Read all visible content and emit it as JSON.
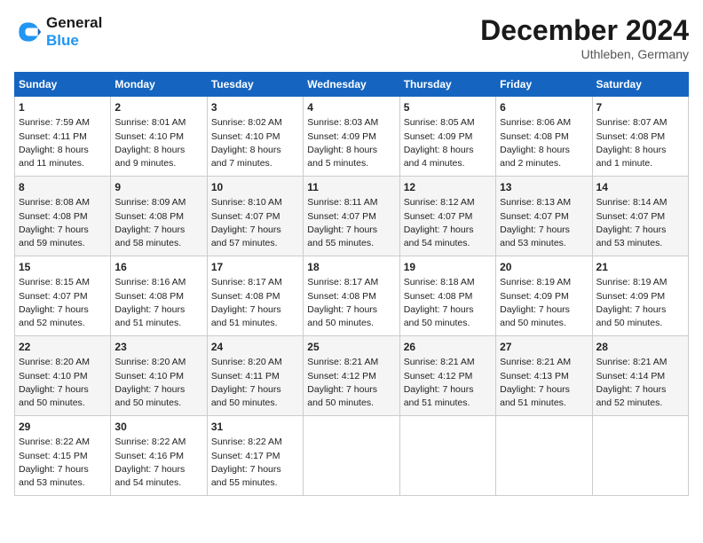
{
  "header": {
    "logo_line1": "General",
    "logo_line2": "Blue",
    "month": "December 2024",
    "location": "Uthleben, Germany"
  },
  "weekdays": [
    "Sunday",
    "Monday",
    "Tuesday",
    "Wednesday",
    "Thursday",
    "Friday",
    "Saturday"
  ],
  "weeks": [
    [
      {
        "day": "1",
        "lines": [
          "Sunrise: 7:59 AM",
          "Sunset: 4:11 PM",
          "Daylight: 8 hours",
          "and 11 minutes."
        ]
      },
      {
        "day": "2",
        "lines": [
          "Sunrise: 8:01 AM",
          "Sunset: 4:10 PM",
          "Daylight: 8 hours",
          "and 9 minutes."
        ]
      },
      {
        "day": "3",
        "lines": [
          "Sunrise: 8:02 AM",
          "Sunset: 4:10 PM",
          "Daylight: 8 hours",
          "and 7 minutes."
        ]
      },
      {
        "day": "4",
        "lines": [
          "Sunrise: 8:03 AM",
          "Sunset: 4:09 PM",
          "Daylight: 8 hours",
          "and 5 minutes."
        ]
      },
      {
        "day": "5",
        "lines": [
          "Sunrise: 8:05 AM",
          "Sunset: 4:09 PM",
          "Daylight: 8 hours",
          "and 4 minutes."
        ]
      },
      {
        "day": "6",
        "lines": [
          "Sunrise: 8:06 AM",
          "Sunset: 4:08 PM",
          "Daylight: 8 hours",
          "and 2 minutes."
        ]
      },
      {
        "day": "7",
        "lines": [
          "Sunrise: 8:07 AM",
          "Sunset: 4:08 PM",
          "Daylight: 8 hours",
          "and 1 minute."
        ]
      }
    ],
    [
      {
        "day": "8",
        "lines": [
          "Sunrise: 8:08 AM",
          "Sunset: 4:08 PM",
          "Daylight: 7 hours",
          "and 59 minutes."
        ]
      },
      {
        "day": "9",
        "lines": [
          "Sunrise: 8:09 AM",
          "Sunset: 4:08 PM",
          "Daylight: 7 hours",
          "and 58 minutes."
        ]
      },
      {
        "day": "10",
        "lines": [
          "Sunrise: 8:10 AM",
          "Sunset: 4:07 PM",
          "Daylight: 7 hours",
          "and 57 minutes."
        ]
      },
      {
        "day": "11",
        "lines": [
          "Sunrise: 8:11 AM",
          "Sunset: 4:07 PM",
          "Daylight: 7 hours",
          "and 55 minutes."
        ]
      },
      {
        "day": "12",
        "lines": [
          "Sunrise: 8:12 AM",
          "Sunset: 4:07 PM",
          "Daylight: 7 hours",
          "and 54 minutes."
        ]
      },
      {
        "day": "13",
        "lines": [
          "Sunrise: 8:13 AM",
          "Sunset: 4:07 PM",
          "Daylight: 7 hours",
          "and 53 minutes."
        ]
      },
      {
        "day": "14",
        "lines": [
          "Sunrise: 8:14 AM",
          "Sunset: 4:07 PM",
          "Daylight: 7 hours",
          "and 53 minutes."
        ]
      }
    ],
    [
      {
        "day": "15",
        "lines": [
          "Sunrise: 8:15 AM",
          "Sunset: 4:07 PM",
          "Daylight: 7 hours",
          "and 52 minutes."
        ]
      },
      {
        "day": "16",
        "lines": [
          "Sunrise: 8:16 AM",
          "Sunset: 4:08 PM",
          "Daylight: 7 hours",
          "and 51 minutes."
        ]
      },
      {
        "day": "17",
        "lines": [
          "Sunrise: 8:17 AM",
          "Sunset: 4:08 PM",
          "Daylight: 7 hours",
          "and 51 minutes."
        ]
      },
      {
        "day": "18",
        "lines": [
          "Sunrise: 8:17 AM",
          "Sunset: 4:08 PM",
          "Daylight: 7 hours",
          "and 50 minutes."
        ]
      },
      {
        "day": "19",
        "lines": [
          "Sunrise: 8:18 AM",
          "Sunset: 4:08 PM",
          "Daylight: 7 hours",
          "and 50 minutes."
        ]
      },
      {
        "day": "20",
        "lines": [
          "Sunrise: 8:19 AM",
          "Sunset: 4:09 PM",
          "Daylight: 7 hours",
          "and 50 minutes."
        ]
      },
      {
        "day": "21",
        "lines": [
          "Sunrise: 8:19 AM",
          "Sunset: 4:09 PM",
          "Daylight: 7 hours",
          "and 50 minutes."
        ]
      }
    ],
    [
      {
        "day": "22",
        "lines": [
          "Sunrise: 8:20 AM",
          "Sunset: 4:10 PM",
          "Daylight: 7 hours",
          "and 50 minutes."
        ]
      },
      {
        "day": "23",
        "lines": [
          "Sunrise: 8:20 AM",
          "Sunset: 4:10 PM",
          "Daylight: 7 hours",
          "and 50 minutes."
        ]
      },
      {
        "day": "24",
        "lines": [
          "Sunrise: 8:20 AM",
          "Sunset: 4:11 PM",
          "Daylight: 7 hours",
          "and 50 minutes."
        ]
      },
      {
        "day": "25",
        "lines": [
          "Sunrise: 8:21 AM",
          "Sunset: 4:12 PM",
          "Daylight: 7 hours",
          "and 50 minutes."
        ]
      },
      {
        "day": "26",
        "lines": [
          "Sunrise: 8:21 AM",
          "Sunset: 4:12 PM",
          "Daylight: 7 hours",
          "and 51 minutes."
        ]
      },
      {
        "day": "27",
        "lines": [
          "Sunrise: 8:21 AM",
          "Sunset: 4:13 PM",
          "Daylight: 7 hours",
          "and 51 minutes."
        ]
      },
      {
        "day": "28",
        "lines": [
          "Sunrise: 8:21 AM",
          "Sunset: 4:14 PM",
          "Daylight: 7 hours",
          "and 52 minutes."
        ]
      }
    ],
    [
      {
        "day": "29",
        "lines": [
          "Sunrise: 8:22 AM",
          "Sunset: 4:15 PM",
          "Daylight: 7 hours",
          "and 53 minutes."
        ]
      },
      {
        "day": "30",
        "lines": [
          "Sunrise: 8:22 AM",
          "Sunset: 4:16 PM",
          "Daylight: 7 hours",
          "and 54 minutes."
        ]
      },
      {
        "day": "31",
        "lines": [
          "Sunrise: 8:22 AM",
          "Sunset: 4:17 PM",
          "Daylight: 7 hours",
          "and 55 minutes."
        ]
      },
      null,
      null,
      null,
      null
    ]
  ]
}
